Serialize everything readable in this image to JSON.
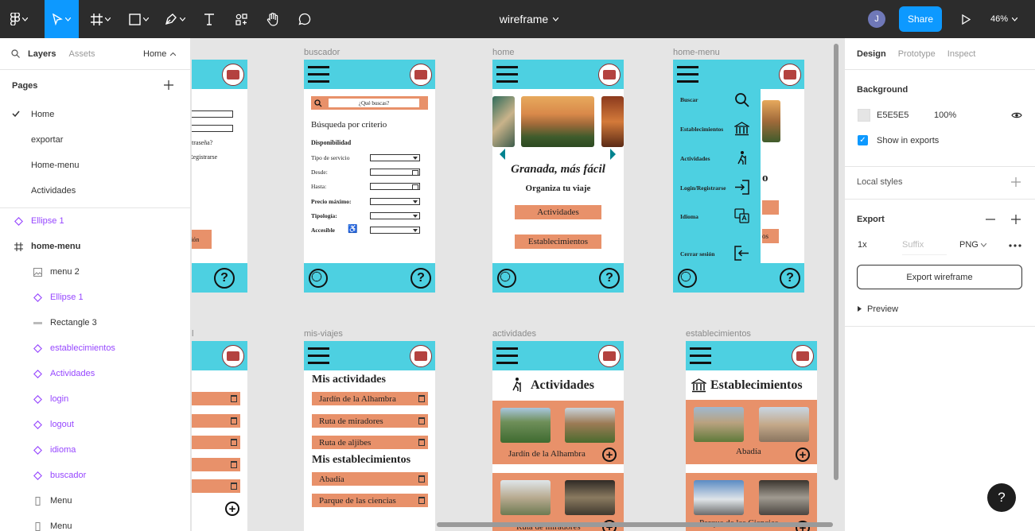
{
  "toolbar": {
    "title": "wireframe",
    "share_label": "Share",
    "avatar_initial": "J",
    "zoom": "46%"
  },
  "left_panel": {
    "tab_layers": "Layers",
    "tab_assets": "Assets",
    "page_selector": "Home",
    "pages_heading": "Pages",
    "pages": [
      {
        "label": "Home",
        "current": true
      },
      {
        "label": "exportar",
        "current": false
      },
      {
        "label": "Home-menu",
        "current": false
      },
      {
        "label": "Actividades",
        "current": false
      }
    ],
    "layers": [
      {
        "label": "Ellipse 1",
        "kind": "component",
        "indent": 0
      },
      {
        "label": "home-menu",
        "kind": "frame",
        "indent": 0
      },
      {
        "label": "menu 2",
        "kind": "image",
        "indent": 1
      },
      {
        "label": "Ellipse 1",
        "kind": "component",
        "indent": 1
      },
      {
        "label": "Rectangle 3",
        "kind": "rectangle",
        "indent": 1
      },
      {
        "label": "establecimientos",
        "kind": "component",
        "indent": 1
      },
      {
        "label": "Actividades",
        "kind": "component",
        "indent": 1
      },
      {
        "label": "login",
        "kind": "component",
        "indent": 1
      },
      {
        "label": "logout",
        "kind": "component",
        "indent": 1
      },
      {
        "label": "idioma",
        "kind": "component",
        "indent": 1
      },
      {
        "label": "buscador",
        "kind": "component",
        "indent": 1
      },
      {
        "label": "Menu",
        "kind": "text",
        "indent": 1
      },
      {
        "label": "Menu",
        "kind": "text",
        "indent": 1
      }
    ]
  },
  "canvas": {
    "frame_labels": {
      "buscador": "buscador",
      "home": "home",
      "home_menu": "home-menu",
      "partial_bottom": "l",
      "mis_viajes": "mis-viajes",
      "actividades": "actividades",
      "establecimientos": "establecimientos"
    },
    "login_frame": {
      "texts": [
        "ntraseña?",
        "/ Registrarse",
        "sión"
      ]
    },
    "buscador_frame": {
      "search_placeholder": "¿Qué buscas?",
      "title": "Búsqueda por criterio",
      "availability": "Disponibilidad",
      "fields": [
        "Tipo de servicio",
        "Desde:",
        "Hasta:",
        "Precio máximo:",
        "Tipología:",
        "Accesible"
      ],
      "accessible_icon": "♿"
    },
    "home_frame": {
      "headline": "Granada, más fácil",
      "subtitle": "Organiza tu viaje",
      "btn_actividades": "Actividades",
      "btn_establecimientos": "Establecimientos"
    },
    "home_menu_frame": {
      "items": [
        "Buscar",
        "Establecimientos",
        "Actividades",
        "Login/Registrarse",
        "Idioma",
        "Cerrar sesión"
      ],
      "peek_text": "o",
      "peek_bar": "os"
    },
    "mis_viajes_frame": {
      "title_activities": "Mis actividades",
      "activities": [
        "Jardín de la Alhambra",
        "Ruta de miradores",
        "Ruta de aljibes"
      ],
      "title_establishments": "Mis establecimientos",
      "establishments": [
        "Abadía",
        "Parque de las ciencias"
      ]
    },
    "actividades_frame": {
      "title": "Actividades",
      "card1": "Jardín de la Alhambra",
      "card2": "Ruta de miradores"
    },
    "establecimientos_frame": {
      "title": "Establecimientos",
      "card1": "Abadía",
      "card2": "Parque de las Ciencias"
    }
  },
  "right_panel": {
    "tab_design": "Design",
    "tab_prototype": "Prototype",
    "tab_inspect": "Inspect",
    "background_heading": "Background",
    "bg_hex": "E5E5E5",
    "bg_opacity": "100%",
    "show_in_exports": "Show in exports",
    "local_styles": "Local styles",
    "export_heading": "Export",
    "export_scale": "1x",
    "suffix_placeholder": "Suffix",
    "export_format": "PNG",
    "export_button": "Export wireframe",
    "preview": "Preview"
  },
  "help_fab": "?",
  "colors": {
    "accent": "#0d99ff",
    "wire_cyan": "#4dd0e1",
    "wire_orange": "#e8916a",
    "component_purple": "#9747ff"
  }
}
